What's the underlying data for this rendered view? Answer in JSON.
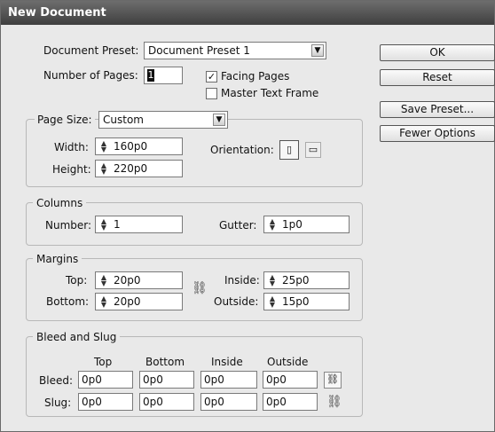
{
  "window": {
    "title": "New Document"
  },
  "preset": {
    "label": "Document Preset:",
    "value": "Document Preset 1"
  },
  "pages": {
    "label": "Number of Pages:",
    "value": "1"
  },
  "facing_pages": {
    "label": "Facing Pages",
    "checked": true,
    "check_glyph": "✓"
  },
  "master_text_frame": {
    "label": "Master Text Frame",
    "checked": false
  },
  "page_size": {
    "label": "Page Size:",
    "value": "Custom",
    "width_label": "Width:",
    "width": "160p0",
    "height_label": "Height:",
    "height": "220p0",
    "orientation_label": "Orientation:"
  },
  "columns": {
    "legend": "Columns",
    "number_label": "Number:",
    "number": "1",
    "gutter_label": "Gutter:",
    "gutter": "1p0"
  },
  "margins": {
    "legend": "Margins",
    "top_label": "Top:",
    "top": "20p0",
    "bottom_label": "Bottom:",
    "bottom": "20p0",
    "inside_label": "Inside:",
    "inside": "25p0",
    "outside_label": "Outside:",
    "outside": "15p0"
  },
  "bleed_slug": {
    "legend": "Bleed and Slug",
    "headers": [
      "Top",
      "Bottom",
      "Inside",
      "Outside"
    ],
    "bleed_label": "Bleed:",
    "bleed": [
      "0p0",
      "0p0",
      "0p0",
      "0p0"
    ],
    "slug_label": "Slug:",
    "slug": [
      "0p0",
      "0p0",
      "0p0",
      "0p0"
    ]
  },
  "buttons": {
    "ok": "OK",
    "reset": "Reset",
    "save_preset": "Save Preset...",
    "fewer_options": "Fewer Options"
  },
  "icons": {
    "dropdown": "chevron-down-icon",
    "spinner": "spinner-arrows-icon",
    "portrait": "portrait-orientation-icon",
    "landscape": "landscape-orientation-icon",
    "chain": "chain-link-icon"
  }
}
